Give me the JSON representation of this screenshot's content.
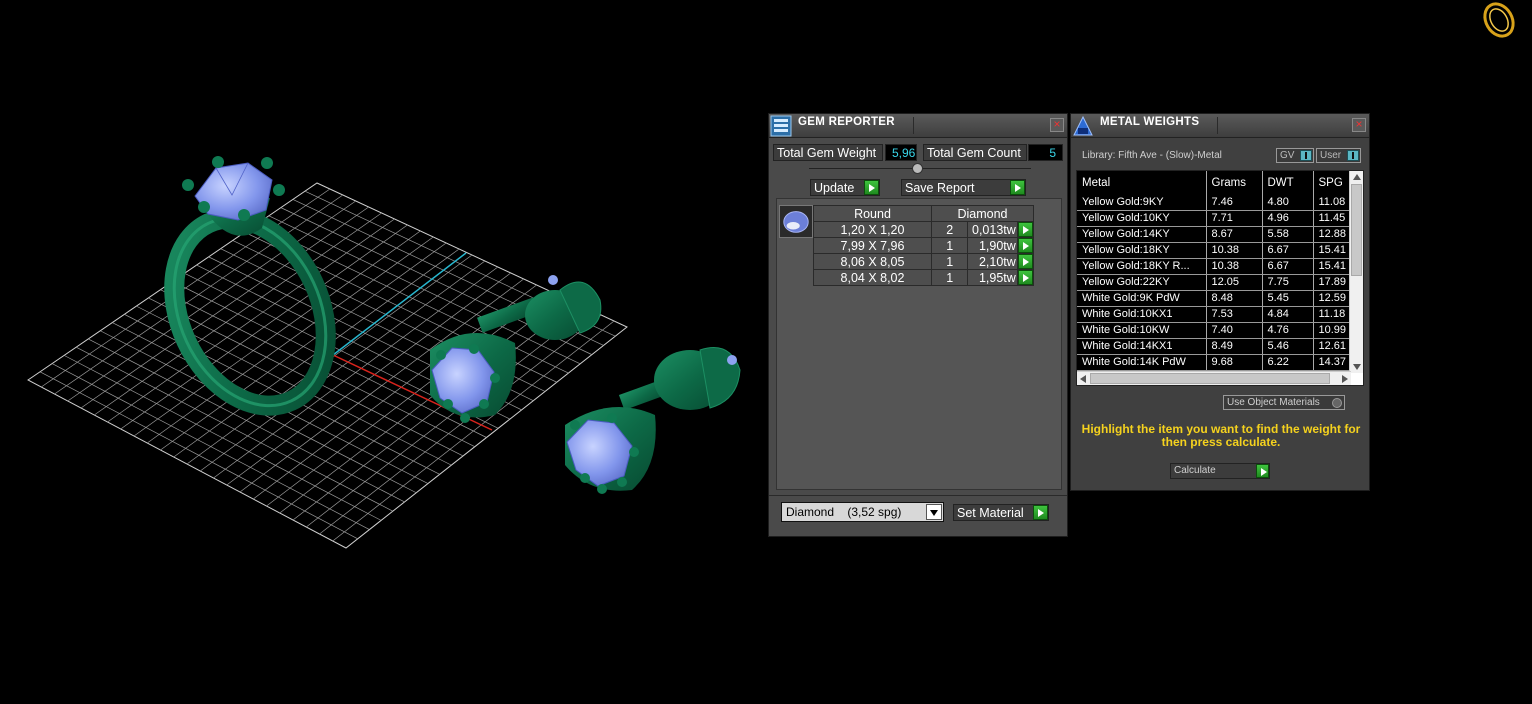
{
  "gem_reporter": {
    "title": "GEM REPORTER",
    "total_gem_weight_label": "Total Gem Weight",
    "total_gem_weight_value": "5,96",
    "total_gem_count_label": "Total Gem Count",
    "total_gem_count_value": "5",
    "update_label": "Update",
    "save_report_label": "Save Report",
    "table_headers": [
      "Round",
      "Diamond"
    ],
    "rows": [
      {
        "size": "1,20 X 1,20",
        "count": "2",
        "weight": "0,013tw"
      },
      {
        "size": "7,99 X 7,96",
        "count": "1",
        "weight": "1,90tw"
      },
      {
        "size": "8,06 X 8,05",
        "count": "1",
        "weight": "2,10tw"
      },
      {
        "size": "8,04 X 8,02",
        "count": "1",
        "weight": "1,95tw"
      }
    ],
    "material_select": "Diamond    (3,52 spg)",
    "set_material_label": "Set Material"
  },
  "metal_weights": {
    "title": "METAL WEIGHTS",
    "library": "Library: Fifth Ave - (Slow)-Metal",
    "gv_label": "GV",
    "user_label": "User",
    "headers": [
      "Metal",
      "Grams",
      "DWT",
      "SPG"
    ],
    "rows": [
      [
        "Yellow Gold:9KY",
        "7.46",
        "4.80",
        "11.08"
      ],
      [
        "Yellow Gold:10KY",
        "7.71",
        "4.96",
        "11.45"
      ],
      [
        "Yellow Gold:14KY",
        "8.67",
        "5.58",
        "12.88"
      ],
      [
        "Yellow Gold:18KY",
        "10.38",
        "6.67",
        "15.41"
      ],
      [
        "Yellow Gold:18KY R...",
        "10.38",
        "6.67",
        "15.41"
      ],
      [
        "Yellow Gold:22KY",
        "12.05",
        "7.75",
        "17.89"
      ],
      [
        "White Gold:9K PdW",
        "8.48",
        "5.45",
        "12.59"
      ],
      [
        "White Gold:10KX1",
        "7.53",
        "4.84",
        "11.18"
      ],
      [
        "White Gold:10KW",
        "7.40",
        "4.76",
        "10.99"
      ],
      [
        "White Gold:14KX1",
        "8.49",
        "5.46",
        "12.61"
      ],
      [
        "White Gold:14K PdW",
        "9.68",
        "6.22",
        "14.37"
      ]
    ],
    "use_object_materials_label": "Use Object Materials",
    "note": "Highlight the item you want to find the weight for then press calculate.",
    "calculate_label": "Calculate"
  },
  "colors": {
    "metal_green": "#0f6e4a",
    "gem_blue": "#8da2f0",
    "grid": "#bdbdbd",
    "axis_x": "#d8231c",
    "axis_y": "#28b7cf",
    "note_yellow": "#f5d21e",
    "value_cyan": "#39d5e8"
  },
  "icons": [
    "gem-reporter-icon",
    "metal-weights-icon",
    "ring-logo-icon",
    "close-icon",
    "play-arrow-icon",
    "dropdown-arrow-icon"
  ]
}
